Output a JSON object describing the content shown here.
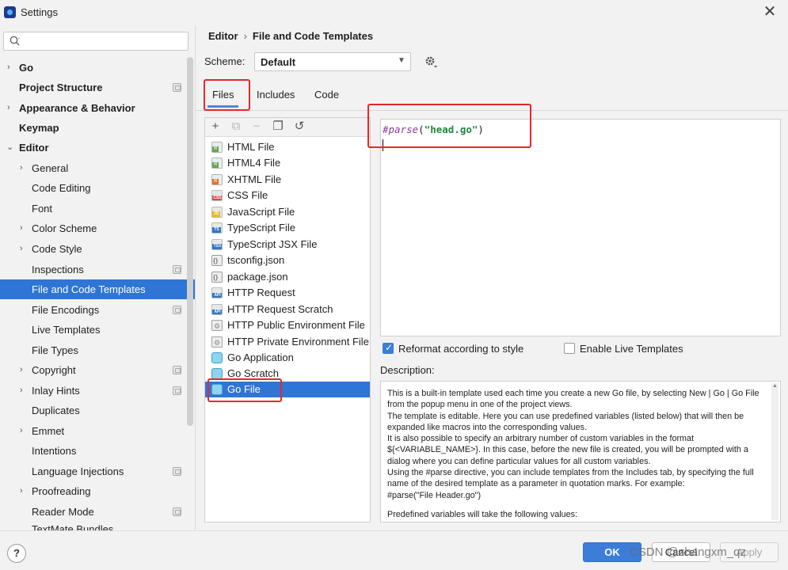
{
  "window": {
    "title": "Settings",
    "close": "✕"
  },
  "search": {
    "placeholder": ""
  },
  "sidebar": {
    "items": [
      {
        "label": "Go"
      },
      {
        "label": "Project Structure"
      },
      {
        "label": "Appearance & Behavior"
      },
      {
        "label": "Keymap"
      },
      {
        "label": "Editor"
      },
      {
        "label": "General"
      },
      {
        "label": "Code Editing"
      },
      {
        "label": "Font"
      },
      {
        "label": "Color Scheme"
      },
      {
        "label": "Code Style"
      },
      {
        "label": "Inspections"
      },
      {
        "label": "File and Code Templates"
      },
      {
        "label": "File Encodings"
      },
      {
        "label": "Live Templates"
      },
      {
        "label": "File Types"
      },
      {
        "label": "Copyright"
      },
      {
        "label": "Inlay Hints"
      },
      {
        "label": "Duplicates"
      },
      {
        "label": "Emmet"
      },
      {
        "label": "Intentions"
      },
      {
        "label": "Language Injections"
      },
      {
        "label": "Proofreading"
      },
      {
        "label": "Reader Mode"
      },
      {
        "label": "TextMate Bundles"
      }
    ]
  },
  "breadcrumb": {
    "parent": "Editor",
    "sep": "›",
    "current": "File and Code Templates"
  },
  "scheme": {
    "label": "Scheme:",
    "value": "Default"
  },
  "tabs": [
    {
      "label": "Files"
    },
    {
      "label": "Includes"
    },
    {
      "label": "Code"
    }
  ],
  "toolbar": {
    "add": "+",
    "copy_disabled": "⧉",
    "remove": "−",
    "duplicate": "❐",
    "reset": "↺"
  },
  "files": [
    {
      "label": "HTML File"
    },
    {
      "label": "HTML4 File"
    },
    {
      "label": "XHTML File"
    },
    {
      "label": "CSS File"
    },
    {
      "label": "JavaScript File"
    },
    {
      "label": "TypeScript File"
    },
    {
      "label": "TypeScript JSX File"
    },
    {
      "label": "tsconfig.json"
    },
    {
      "label": "package.json"
    },
    {
      "label": "HTTP Request"
    },
    {
      "label": "HTTP Request Scratch"
    },
    {
      "label": "HTTP Public Environment File"
    },
    {
      "label": "HTTP Private Environment File"
    },
    {
      "label": "Go Application"
    },
    {
      "label": "Go Scratch"
    },
    {
      "label": "Go File"
    }
  ],
  "editor": {
    "directive": "#parse",
    "open_paren": "(",
    "string": "\"head.go\"",
    "close_paren": ")"
  },
  "options": {
    "reformat": "Reformat according to style",
    "live_templates": "Enable Live Templates"
  },
  "description": {
    "label": "Description:",
    "p1": "This is a built-in template used each time you create a new Go file, by selecting New | Go | Go File from the popup menu in one of the project views.",
    "p2": "The template is editable. Here you can use predefined variables (listed below) that will then be expanded like macros into the corresponding values.",
    "p3": "It is also possible to specify an arbitrary number of custom variables in the format ${<VARIABLE_NAME>}. In this case, before the new file is created, you will be prompted with a dialog where you can define particular values for all custom variables.",
    "p4": "Using the #parse directive, you can include templates from the Includes tab, by specifying the full name of the desired template as a parameter in quotation marks. For example:",
    "p5": "#parse(\"File Header.go\")",
    "p6": "Predefined variables will take the following values:"
  },
  "buttons": {
    "help": "?",
    "ok": "OK",
    "cancel": "Cancel",
    "apply": "Apply"
  },
  "watermark": "CSDN @zhangxm_qz",
  "colors": {
    "accent": "#2f75d6",
    "annotation": "#e8262a"
  }
}
